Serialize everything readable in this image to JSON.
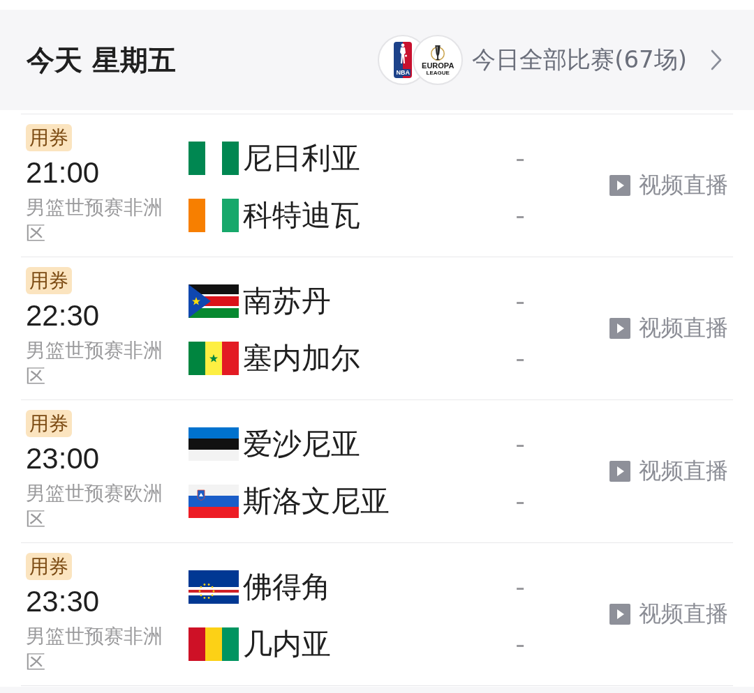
{
  "header": {
    "title": "今天 星期五",
    "league_logos": [
      {
        "kind": "shield",
        "texts": [
          "NBA"
        ]
      },
      {
        "kind": "trophy",
        "texts": [
          "EUROPA",
          "LEAGUE"
        ]
      }
    ],
    "all_matches_link": "今日全部比赛(67场)"
  },
  "matches": [
    {
      "badge": "用券",
      "time": "21:00",
      "competition": "男篮世预赛非洲区",
      "teams": [
        {
          "name": "尼日利亚",
          "kind": "nigeria",
          "score": "-"
        },
        {
          "name": "科特迪瓦",
          "kind": "ivorycoast",
          "score": "-"
        }
      ],
      "video_button": "视频直播"
    },
    {
      "badge": "用券",
      "time": "22:30",
      "competition": "男篮世预赛非洲区",
      "teams": [
        {
          "name": "南苏丹",
          "kind": "southsudan",
          "score": "-"
        },
        {
          "name": "塞内加尔",
          "kind": "senegal",
          "score": "-"
        }
      ],
      "video_button": "视频直播"
    },
    {
      "badge": "用券",
      "time": "23:00",
      "competition": "男篮世预赛欧洲区",
      "teams": [
        {
          "name": "爱沙尼亚",
          "kind": "estonia",
          "score": "-"
        },
        {
          "name": "斯洛文尼亚",
          "kind": "slovenia",
          "score": "-"
        }
      ],
      "video_button": "视频直播"
    },
    {
      "badge": "用券",
      "time": "23:30",
      "competition": "男篮世预赛非洲区",
      "teams": [
        {
          "name": "佛得角",
          "kind": "capeverde",
          "score": "-"
        },
        {
          "name": "几内亚",
          "kind": "guinea",
          "score": "-"
        }
      ],
      "video_button": "视频直播"
    }
  ]
}
